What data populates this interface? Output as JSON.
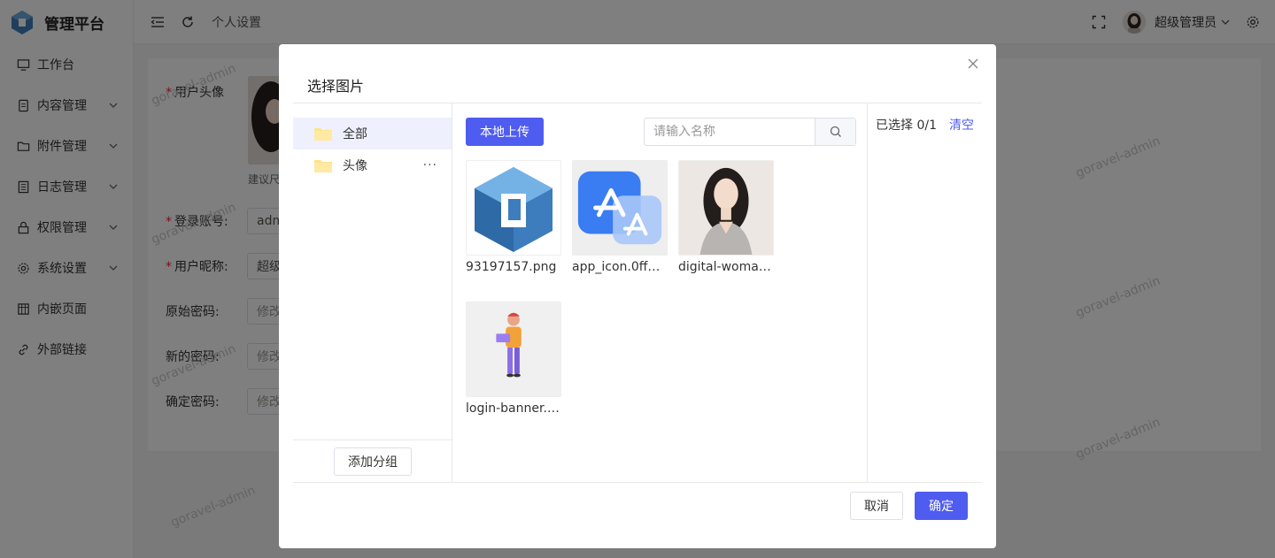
{
  "app": {
    "title": "管理平台"
  },
  "sidebar": {
    "items": [
      {
        "label": "工作台",
        "icon": "monitor-icon",
        "has_children": false
      },
      {
        "label": "内容管理",
        "icon": "document-icon",
        "has_children": true
      },
      {
        "label": "附件管理",
        "icon": "folder-icon",
        "has_children": true
      },
      {
        "label": "日志管理",
        "icon": "list-icon",
        "has_children": true
      },
      {
        "label": "权限管理",
        "icon": "lock-icon",
        "has_children": true
      },
      {
        "label": "系统设置",
        "icon": "gear-icon",
        "has_children": true
      },
      {
        "label": "内嵌页面",
        "icon": "grid-icon",
        "has_children": false
      },
      {
        "label": "外部链接",
        "icon": "link-icon",
        "has_children": false
      }
    ]
  },
  "header": {
    "breadcrumb": "个人设置",
    "user_name": "超级管理员"
  },
  "form": {
    "avatar_label": "用户头像",
    "avatar_hint": "建议尺",
    "account_label": "登录账号:",
    "account_value": "adm",
    "nickname_label": "用户昵称:",
    "nickname_value": "超级",
    "old_pwd_label": "原始密码:",
    "new_pwd_label": "新的密码:",
    "confirm_pwd_label": "确定密码:",
    "pwd_placeholder": "修改"
  },
  "watermark": "goravel-admin",
  "dialog": {
    "title": "选择图片",
    "groups": [
      {
        "label": "全部",
        "active": true
      },
      {
        "label": "头像",
        "active": false,
        "more": "···"
      }
    ],
    "add_group_label": "添加分组",
    "upload_label": "本地上传",
    "search_placeholder": "请输入名称",
    "files": [
      {
        "name": "93197157.png",
        "thumb": "logo-cube"
      },
      {
        "name": "app_icon.0ff0…",
        "thumb": "app-store-icon"
      },
      {
        "name": "digital-woma…",
        "thumb": "portrait"
      },
      {
        "name": "login-banner.…",
        "thumb": "figure-illustration"
      }
    ],
    "selected_text": "已选择 0/1",
    "clear_label": "清空",
    "cancel_label": "取消",
    "confirm_label": "确定"
  },
  "colors": {
    "primary": "#4f5cf0",
    "required": "#f5222d",
    "active_group_bg": "#eef0fd"
  }
}
